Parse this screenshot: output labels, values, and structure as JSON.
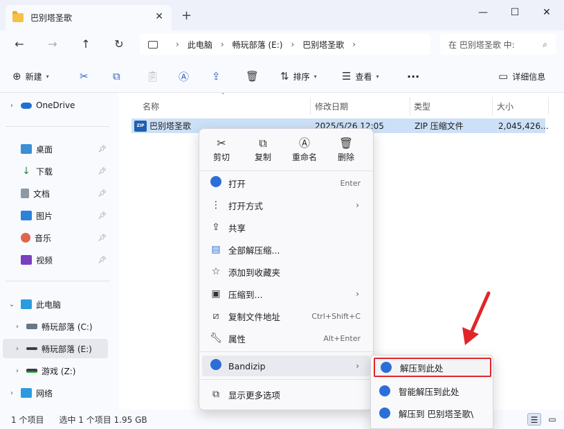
{
  "window": {
    "tab_title": "巴别塔圣歌",
    "tab_close": "✕",
    "new_tab": "+",
    "minimize": "—",
    "maximize": "☐",
    "close": "✕"
  },
  "nav": {
    "back": "←",
    "forward": "→",
    "up": "↑",
    "refresh": "↻",
    "breadcrumb": [
      "此电脑",
      "畅玩部落 (E:)",
      "巴别塔圣歌"
    ],
    "search_placeholder": "在 巴别塔圣歌 中:"
  },
  "toolbar": {
    "new_label": "新建",
    "sort_label": "排序",
    "view_label": "查看",
    "more": "···",
    "details_label": "详细信息"
  },
  "sidebar": {
    "items": [
      {
        "label": "OneDrive",
        "icon": "onedrive-icon"
      },
      {
        "label": "桌面",
        "icon": "desktop-icon"
      },
      {
        "label": "下载",
        "icon": "download-icon"
      },
      {
        "label": "文档",
        "icon": "document-icon"
      },
      {
        "label": "图片",
        "icon": "pictures-icon"
      },
      {
        "label": "音乐",
        "icon": "music-icon"
      },
      {
        "label": "视频",
        "icon": "video-icon"
      },
      {
        "label": "此电脑",
        "icon": "computer-icon"
      },
      {
        "label": "畅玩部落 (C:)",
        "icon": "drive-icon"
      },
      {
        "label": "畅玩部落 (E:)",
        "icon": "drive-icon"
      },
      {
        "label": "游戏 (Z:)",
        "icon": "drive-icon"
      },
      {
        "label": "网络",
        "icon": "network-icon"
      }
    ]
  },
  "filelist": {
    "columns": [
      "名称",
      "修改日期",
      "类型",
      "大小"
    ],
    "rows": [
      {
        "name": "巴别塔圣歌",
        "date": "2025/5/26 12:05",
        "type": "ZIP 压缩文件",
        "size": "2,045,426..."
      }
    ]
  },
  "status": {
    "count": "1 个项目",
    "selected": "选中 1 个项目  1.95 GB"
  },
  "context_menu": {
    "top_actions": [
      {
        "label": "剪切",
        "icon": "scissors-icon"
      },
      {
        "label": "复制",
        "icon": "copy-icon"
      },
      {
        "label": "重命名",
        "icon": "rename-icon"
      },
      {
        "label": "删除",
        "icon": "trash-icon"
      }
    ],
    "items": [
      {
        "label": "打开",
        "shortcut": "Enter"
      },
      {
        "label": "打开方式",
        "shortcut": ""
      },
      {
        "label": "共享",
        "shortcut": ""
      },
      {
        "label": "全部解压缩...",
        "shortcut": ""
      },
      {
        "label": "添加到收藏夹",
        "shortcut": ""
      },
      {
        "label": "压缩到...",
        "shortcut": ""
      },
      {
        "label": "复制文件地址",
        "shortcut": "Ctrl+Shift+C"
      },
      {
        "label": "属性",
        "shortcut": "Alt+Enter"
      },
      {
        "label": "Bandizip",
        "shortcut": ""
      },
      {
        "label": "显示更多选项",
        "shortcut": ""
      }
    ]
  },
  "submenu": {
    "items": [
      "解压到此处",
      "智能解压到此处",
      "解压到 巴别塔圣歌\\"
    ]
  },
  "colors": {
    "accent": "#2c6ed8",
    "selection": "#cce0f7",
    "highlight_border": "#e0262a"
  }
}
